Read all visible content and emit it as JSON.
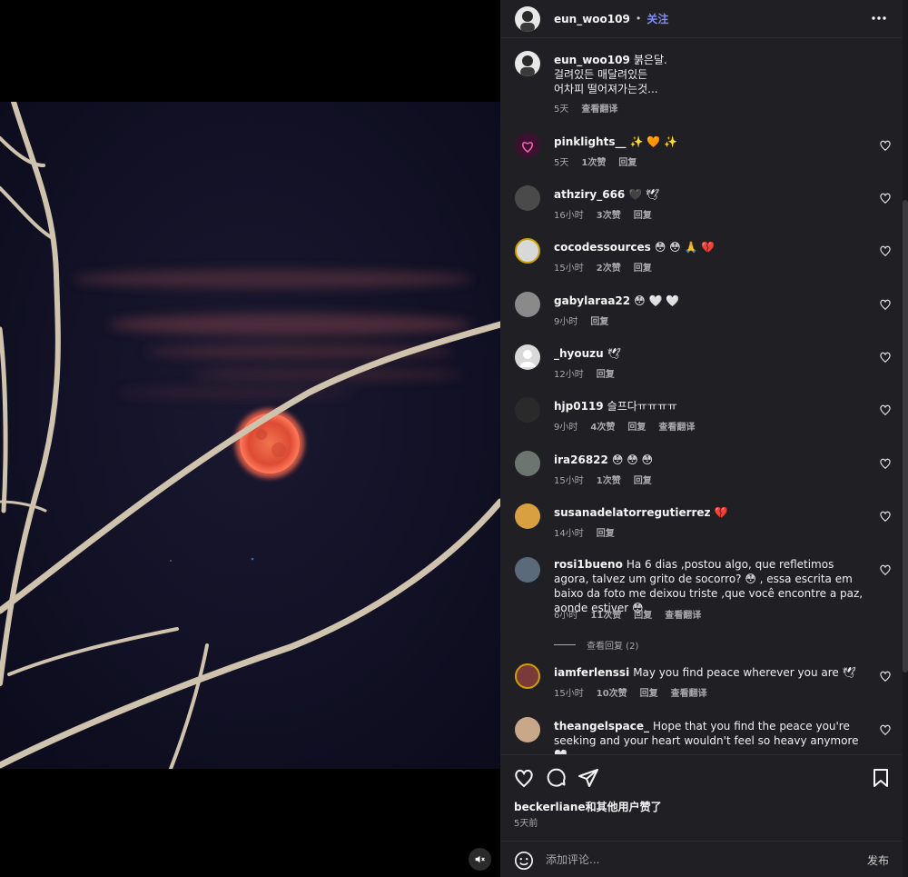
{
  "header": {
    "username": "eun_woo109",
    "separator": "•",
    "follow_label": "关注"
  },
  "caption": {
    "username": "eun_woo109",
    "text": "붉은달.\n걸려있든 매달려있든\n어차피 떨어져가는것...",
    "time": "5天",
    "translate_label": "查看翻译"
  },
  "comments": [
    {
      "username": "pinklights__",
      "text": "✨ 🧡 ✨",
      "time": "5天",
      "likes": "1次赞",
      "reply": "回复",
      "translate": ""
    },
    {
      "username": "athziry_666",
      "text": "🖤 🕊",
      "time": "16小时",
      "likes": "3次赞",
      "reply": "回复",
      "translate": ""
    },
    {
      "username": "cocodessources",
      "text": "😳 😳 🙏 💔",
      "time": "15小时",
      "likes": "2次赞",
      "reply": "回复",
      "translate": ""
    },
    {
      "username": "gabylaraa22",
      "text": "😳 🤍 🤍",
      "time": "9小时",
      "likes": "",
      "reply": "回复",
      "translate": ""
    },
    {
      "username": "_hyouzu",
      "text": "🕊",
      "time": "12小时",
      "likes": "",
      "reply": "回复",
      "translate": ""
    },
    {
      "username": "hjp0119",
      "text": "슬프다ㅠㅠㅠㅠ",
      "time": "9小时",
      "likes": "4次赞",
      "reply": "回复",
      "translate": "查看翻译"
    },
    {
      "username": "ira26822",
      "text": "😳 😳 😳",
      "time": "15小时",
      "likes": "1次赞",
      "reply": "回复",
      "translate": ""
    },
    {
      "username": "susanadelatorregutierrez",
      "text": "💔",
      "time": "14小时",
      "likes": "",
      "reply": "回复",
      "translate": ""
    },
    {
      "username": "rosi1bueno",
      "text": "Ha 6 dias ,postou algo, que refletimos agora, talvez um grito de socorro? 😳 , essa escrita em baixo da foto me deixou triste ,que você encontre a paz, aonde estiver 😳,",
      "time": "6小时",
      "likes": "11次赞",
      "reply": "回复",
      "translate": "查看翻译"
    },
    {
      "username": "iamferlenssi",
      "text": "May you find peace wherever you are 🕊",
      "time": "15小时",
      "likes": "10次赞",
      "reply": "回复",
      "translate": "查看翻译"
    },
    {
      "username": "theangelspace_",
      "text": "Hope that you find the peace you're seeking and your heart wouldn't feel so heavy anymore 🤍",
      "time": "",
      "likes": "",
      "reply": "",
      "translate": ""
    }
  ],
  "view_replies_label": "查看回复 (2)",
  "likes_line": "beckerliane和其他用户赞了",
  "post_time": "5天前",
  "composer": {
    "placeholder": "添加评论...",
    "post_label": "发布"
  },
  "colors": {
    "panel_bg": "#202024",
    "link_blue": "#7f8bff",
    "moon": "#e8553d",
    "sky": "#0f0f24"
  }
}
